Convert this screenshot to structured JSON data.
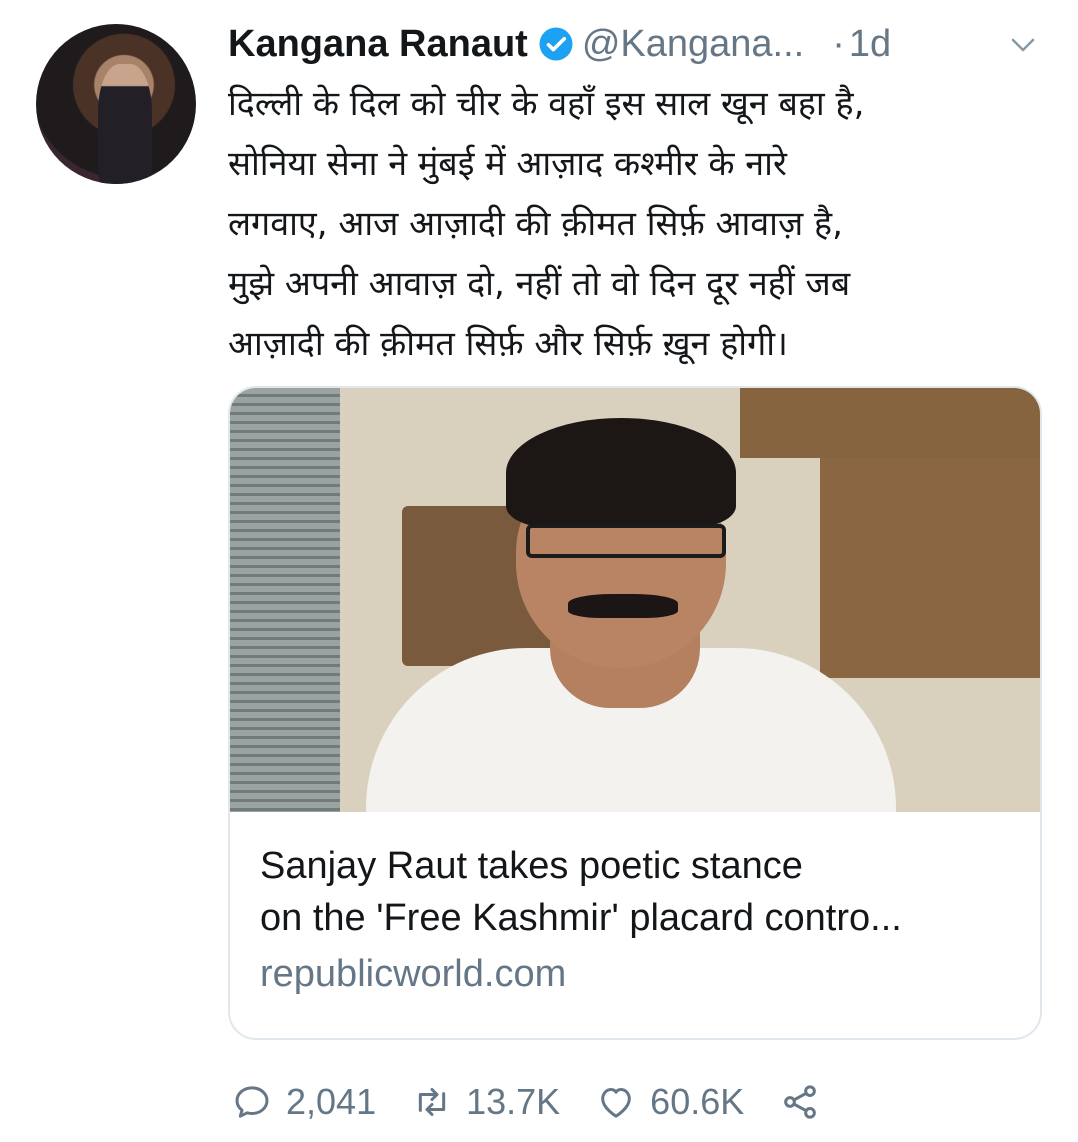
{
  "tweet": {
    "author_name": "Kangana Ranaut",
    "handle": "@Kangana...",
    "separator": "·",
    "time": "1d",
    "text_lines": [
      "दिल्ली के दिल को चीर के वहाँ इस साल खून बहा है,",
      "सोनिया सेना ने मुंबई में आज़ाद कश्मीर के नारे",
      "लगवाए, आज आज़ादी की क़ीमत सिर्फ़ आवाज़ है,",
      "मुझे अपनी आवाज़ दो, नहीं तो वो दिन दूर नहीं जब",
      "आज़ादी की क़ीमत सिर्फ़ और सिर्फ़ ख़ून होगी।"
    ]
  },
  "card": {
    "title_lines": [
      "Sanjay Raut takes poetic stance",
      "on the 'Free Kashmir' placard contro..."
    ],
    "domain": "republicworld.com"
  },
  "actions": {
    "replies": "2,041",
    "retweets": "13.7K",
    "likes": "60.6K"
  },
  "colors": {
    "primary_text": "#14171a",
    "secondary_text": "#657786",
    "verified_blue": "#1da1f2",
    "card_border": "#e1e8ed"
  },
  "icons": [
    "verified-badge-icon",
    "chevron-down-icon",
    "reply-icon",
    "retweet-icon",
    "like-icon",
    "share-icon"
  ]
}
